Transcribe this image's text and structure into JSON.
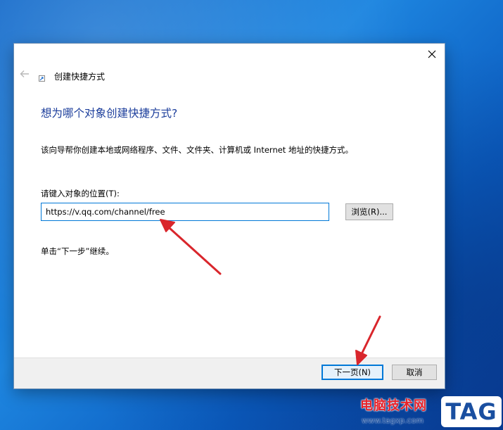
{
  "window": {
    "title": "创建快捷方式",
    "close_icon": "close-icon",
    "back_icon": "back-arrow-icon",
    "app_icon": "shortcut-wizard-icon"
  },
  "content": {
    "heading": "想为哪个对象创建快捷方式?",
    "description": "该向导帮你创建本地或网络程序、文件、文件夹、计算机或 Internet 地址的快捷方式。",
    "location_label": "请键入对象的位置(T):",
    "location_value": "https://v.qq.com/channel/free",
    "browse_label": "浏览(R)...",
    "hint": "单击“下一步”继续。"
  },
  "footer": {
    "next_label": "下一页(N)",
    "cancel_label": "取消"
  },
  "watermark": {
    "site_name": "电脑技术网",
    "site_url": "www.tagxp.com",
    "tag_label": "TAG"
  },
  "colors": {
    "heading": "#1b3d9b",
    "accent": "#0078d7",
    "annotation_arrow": "#d9262c"
  }
}
